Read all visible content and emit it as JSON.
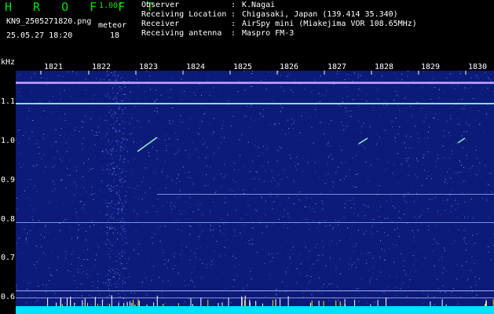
{
  "header": {
    "app_title": "H R O F F T",
    "version": "1.00f",
    "filename": "KN9_2505271820.png",
    "meteor_label": "meteor",
    "datetime": "25.05.27 18:20",
    "meteor_count": "18"
  },
  "info": [
    {
      "label": "Observer",
      "value": "K.Nagai"
    },
    {
      "label": "Receiving Location",
      "value": "Chigasaki, Japan (139.414 35.340)"
    },
    {
      "label": "Receiver",
      "value": "AirSpy mini (Miakejima VOR 108.65MHz)"
    },
    {
      "label": "Receiving antenna",
      "value": "Maspro FM-3"
    }
  ],
  "axis": {
    "unit": "kHz",
    "time_labels": [
      "1821",
      "1822",
      "1823",
      "1824",
      "1825",
      "1826",
      "1827",
      "1828",
      "1829",
      "1830"
    ],
    "freq_labels": [
      "1.1",
      "1.0",
      "0.9",
      "0.8",
      "0.7",
      "0.6"
    ]
  },
  "colors": {
    "background": "#000000",
    "spectrum_bg": "#0c1a78",
    "title_green": "#00e000",
    "text": "#ffffff",
    "carrier_line": "#9ee8ff",
    "baseline": "#00e0ff"
  }
}
